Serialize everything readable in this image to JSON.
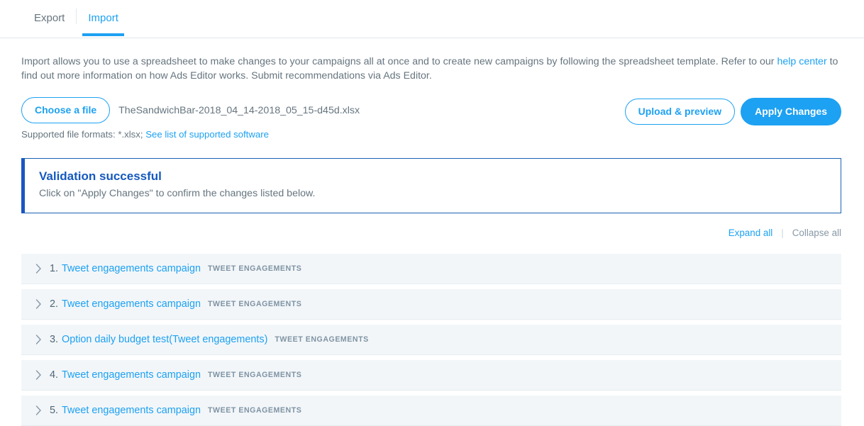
{
  "tabs": [
    {
      "label": "Export",
      "active": false
    },
    {
      "label": "Import",
      "active": true
    }
  ],
  "intro": {
    "part1": "Import allows you to use a spreadsheet to make changes to your campaigns all at once and to create new campaigns by following the spreadsheet template. Refer to our ",
    "help_link": "help center",
    "part2": " to find out more information on how Ads Editor works. Submit recommendations via Ads Editor."
  },
  "file": {
    "choose_label": "Choose a file",
    "filename": "TheSandwichBar-2018_04_14-2018_05_15-d45d.xlsx",
    "formats_prefix": "Supported file formats: *.xlsx; ",
    "formats_link": "See list of supported software"
  },
  "actions": {
    "upload_label": "Upload & preview",
    "apply_label": "Apply Changes"
  },
  "banner": {
    "title": "Validation successful",
    "subtitle": "Click on \"Apply Changes\" to confirm the changes listed below.",
    "accent_color": "#1a56c4",
    "border_color": "#1b62b3"
  },
  "expand_controls": {
    "expand_label": "Expand all",
    "divider": "|",
    "collapse_label": "Collapse all"
  },
  "campaigns": [
    {
      "number": "1.",
      "name": "Tweet engagements campaign",
      "type": "TWEET ENGAGEMENTS"
    },
    {
      "number": "2.",
      "name": "Tweet engagements campaign",
      "type": "TWEET ENGAGEMENTS"
    },
    {
      "number": "3.",
      "name": "Option daily budget test(Tweet engagements)",
      "type": "TWEET ENGAGEMENTS"
    },
    {
      "number": "4.",
      "name": "Tweet engagements campaign",
      "type": "TWEET ENGAGEMENTS"
    },
    {
      "number": "5.",
      "name": "Tweet engagements campaign",
      "type": "TWEET ENGAGEMENTS"
    }
  ],
  "colors": {
    "accent": "#1da1f2",
    "text": "#66757f",
    "row_bg": "#f2f6f9"
  }
}
